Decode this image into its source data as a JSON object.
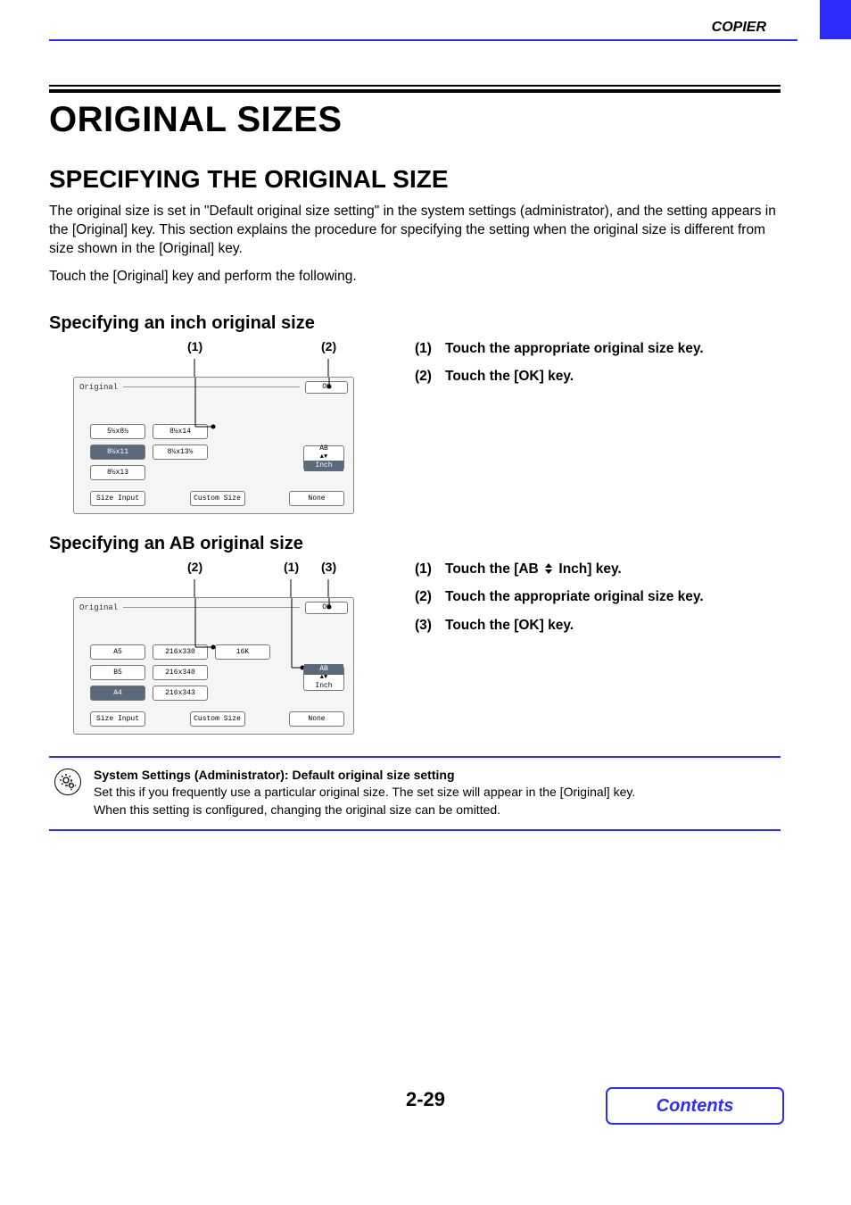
{
  "header": {
    "section": "COPIER"
  },
  "title": "ORIGINAL SIZES",
  "subtitle": "SPECIFYING THE ORIGINAL SIZE",
  "intro": "The original size is set in \"Default original size setting\" in the system settings (administrator), and the setting appears in the [Original] key. This section explains the procedure for specifying the setting when the original size is different from size shown in the [Original] key.",
  "intro2": "Touch the [Original] key and perform the following.",
  "inch": {
    "heading": "Specifying an inch original size",
    "callouts": [
      "(1)",
      "(2)"
    ],
    "panel": {
      "title": "Original",
      "ok": "OK",
      "sizes_col1": [
        "5½x8½",
        "8½x11",
        "8½x13"
      ],
      "sizes_col2": [
        "8½x14",
        "8½x13½"
      ],
      "selected": "8½x11",
      "toggle": {
        "top": "AB",
        "bottom": "Inch",
        "selected": "Inch"
      },
      "size_input": "Size Input",
      "custom_size": "Custom Size",
      "none": "None"
    },
    "steps": [
      {
        "n": "(1)",
        "t": "Touch the appropriate original size key."
      },
      {
        "n": "(2)",
        "t": "Touch the [OK] key."
      }
    ]
  },
  "ab": {
    "heading": "Specifying an AB original size",
    "callouts": [
      "(2)",
      "(1)",
      "(3)"
    ],
    "panel": {
      "title": "Original",
      "ok": "OK",
      "sizes_col1": [
        "A5",
        "B5",
        "A4"
      ],
      "sizes_col2": [
        "216x330",
        "216x340",
        "216x343"
      ],
      "sizes_col3": [
        "16K"
      ],
      "selected": "A4",
      "toggle": {
        "top": "AB",
        "bottom": "Inch",
        "selected": "AB"
      },
      "size_input": "Size Input",
      "custom_size": "Custom Size",
      "none": "None"
    },
    "steps": [
      {
        "n": "(1)",
        "pre": "Touch the [AB",
        "post": "Inch] key."
      },
      {
        "n": "(2)",
        "t": "Touch the appropriate original size key."
      },
      {
        "n": "(3)",
        "t": "Touch the [OK] key."
      }
    ]
  },
  "note": {
    "title": "System Settings (Administrator): Default original size setting",
    "line1": "Set this if you frequently use a particular original size. The set size will appear in the [Original] key.",
    "line2": "When this setting is configured, changing the original size can be omitted."
  },
  "page_number": "2-29",
  "contents": "Contents"
}
